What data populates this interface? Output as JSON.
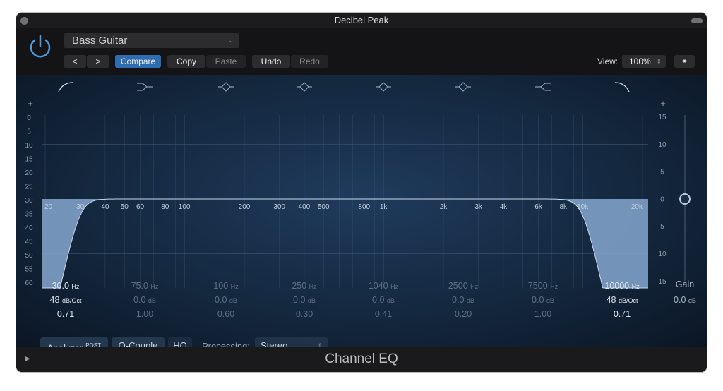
{
  "window": {
    "title": "Decibel Peak",
    "plugin_name": "Channel EQ"
  },
  "toolbar": {
    "preset": "Bass Guitar",
    "prev": "<",
    "next": ">",
    "compare": "Compare",
    "copy": "Copy",
    "paste": "Paste",
    "undo": "Undo",
    "redo": "Redo",
    "view_label": "View:",
    "view_value": "100%",
    "accent": "#2f6db3"
  },
  "analyzer_scale": {
    "plus": "+",
    "ticks": [
      "0",
      "5",
      "10",
      "15",
      "20",
      "25",
      "30",
      "35",
      "40",
      "45",
      "50",
      "55",
      "60"
    ]
  },
  "gain_scale": {
    "plus": "+",
    "ticks": [
      "15",
      "10",
      "5",
      "0",
      "5",
      "10",
      "15"
    ]
  },
  "freq_labels": [
    "20",
    "30",
    "40",
    "50",
    "60",
    "80",
    "100",
    "200",
    "300",
    "400",
    "500",
    "800",
    "1k",
    "2k",
    "3k",
    "4k",
    "6k",
    "8k",
    "10k",
    "20k"
  ],
  "freq_values": [
    20,
    30,
    40,
    50,
    60,
    80,
    100,
    200,
    300,
    400,
    500,
    800,
    1000,
    2000,
    3000,
    4000,
    6000,
    8000,
    10000,
    20000
  ],
  "grid_freqs": [
    20,
    30,
    40,
    50,
    60,
    70,
    80,
    90,
    100,
    200,
    300,
    400,
    500,
    600,
    700,
    800,
    900,
    1000,
    2000,
    3000,
    4000,
    5000,
    6000,
    7000,
    8000,
    9000,
    10000,
    20000
  ],
  "bands": [
    {
      "type": "low-cut-icon",
      "freq": "30.0",
      "freq_unit": "Hz",
      "gain": "48",
      "gain_unit": "dB/Oct",
      "q": "0.71",
      "active": true,
      "hz": 30
    },
    {
      "type": "low-shelf-icon",
      "freq": "75.0",
      "freq_unit": "Hz",
      "gain": "0.0",
      "gain_unit": "dB",
      "q": "1.00",
      "active": false
    },
    {
      "type": "peak-icon",
      "freq": "100",
      "freq_unit": "Hz",
      "gain": "0.0",
      "gain_unit": "dB",
      "q": "0.60",
      "active": false
    },
    {
      "type": "peak-icon",
      "freq": "250",
      "freq_unit": "Hz",
      "gain": "0.0",
      "gain_unit": "dB",
      "q": "0.30",
      "active": false
    },
    {
      "type": "peak-icon",
      "freq": "1040",
      "freq_unit": "Hz",
      "gain": "0.0",
      "gain_unit": "dB",
      "q": "0.41",
      "active": false
    },
    {
      "type": "peak-icon",
      "freq": "2500",
      "freq_unit": "Hz",
      "gain": "0.0",
      "gain_unit": "dB",
      "q": "0.20",
      "active": false
    },
    {
      "type": "high-shelf-icon",
      "freq": "7500",
      "freq_unit": "Hz",
      "gain": "0.0",
      "gain_unit": "dB",
      "q": "1.00",
      "active": false
    },
    {
      "type": "high-cut-icon",
      "freq": "10000",
      "freq_unit": "Hz",
      "gain": "48",
      "gain_unit": "dB/Oct",
      "q": "0.71",
      "active": true,
      "hz": 10000
    }
  ],
  "master_gain": {
    "label": "Gain",
    "value": "0.0",
    "unit": "dB"
  },
  "footer": {
    "analyzer": "Analyzer",
    "analyzer_sup": "POST",
    "qcouple": "Q-Couple",
    "hq": "HQ",
    "processing_label": "Processing:",
    "processing_value": "Stereo"
  }
}
